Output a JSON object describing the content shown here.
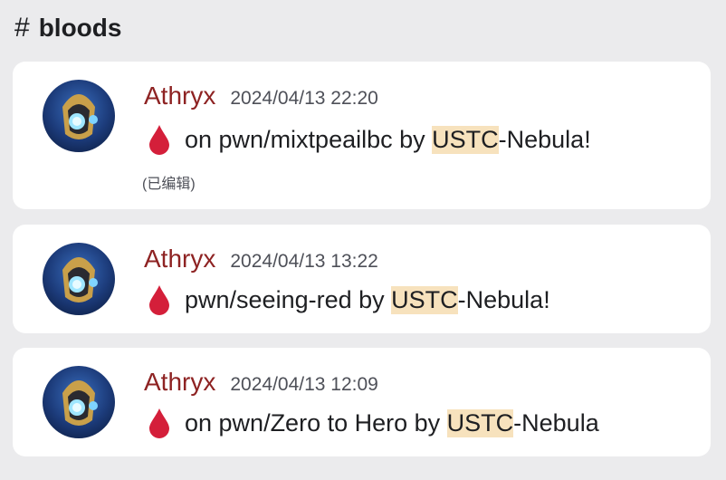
{
  "channel": {
    "icon": "hash-icon",
    "name": "bloods"
  },
  "colors": {
    "author": "#8e2323",
    "highlight": "#f7e2bd",
    "drop": "#d41f3a"
  },
  "messages": [
    {
      "author": "Athryx",
      "timestamp": "2024/04/13 22:20",
      "icon": "blood-drop-icon",
      "text_before": "on pwn/mixtpeailbc by ",
      "highlight": "USTC",
      "text_after": "-Nebula!",
      "edited": "(已编辑)"
    },
    {
      "author": "Athryx",
      "timestamp": "2024/04/13 13:22",
      "icon": "blood-drop-icon",
      "text_before": "pwn/seeing-red by ",
      "highlight": "USTC",
      "text_after": "-Nebula!"
    },
    {
      "author": "Athryx",
      "timestamp": "2024/04/13 12:09",
      "icon": "blood-drop-icon",
      "text_before": "on pwn/Zero to Hero by ",
      "highlight": "USTC",
      "text_after": "-Nebula"
    }
  ]
}
